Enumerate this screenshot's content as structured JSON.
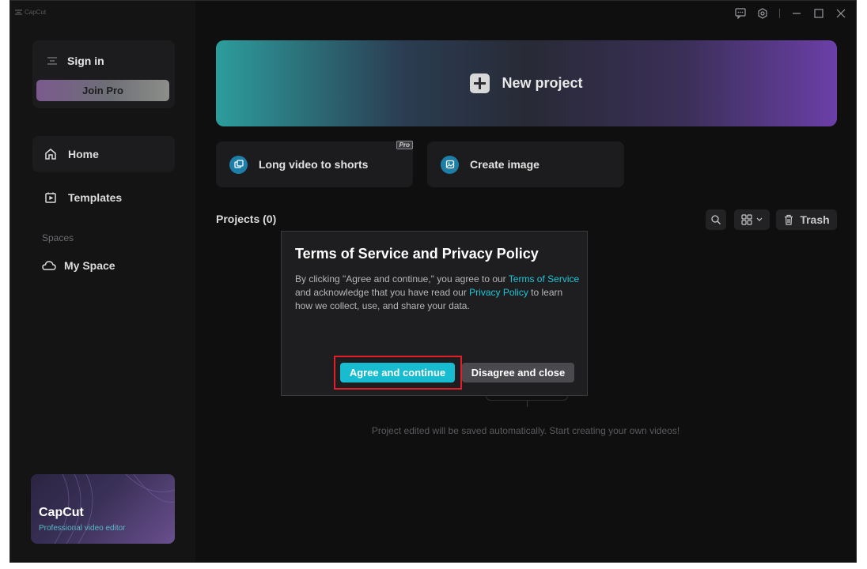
{
  "app": {
    "logo_text": "CapCut"
  },
  "sidebar": {
    "sign_in": "Sign in",
    "join_pro": "Join Pro",
    "nav": [
      {
        "label": "Home",
        "icon": "home-icon",
        "active": true
      },
      {
        "label": "Templates",
        "icon": "templates-icon",
        "active": false
      }
    ],
    "spaces_label": "Spaces",
    "my_space": "My Space",
    "promo": {
      "title": "CapCut",
      "subtitle": "Professional video editor"
    }
  },
  "main": {
    "new_project": "New project",
    "quick_actions": [
      {
        "label": "Long video to shorts",
        "badge": "Pro",
        "icon": "shorts-icon"
      },
      {
        "label": "Create image",
        "icon": "image-icon"
      }
    ],
    "projects_title": "Projects",
    "projects_count": "(0)",
    "trash_label": "Trash",
    "empty_text": "Project edited will be saved automatically. Start creating your own videos!"
  },
  "dialog": {
    "title": "Terms of Service and Privacy Policy",
    "body_1": "By clicking  \"Agree and continue,\"  you agree to our ",
    "terms_link": "Terms of Service",
    "body_2": " and acknowledge that you have read our ",
    "privacy_link": "Privacy Policy",
    "body_3": " to learn how we collect, use, and share your data.",
    "agree": "Agree and continue",
    "disagree": "Disagree and close"
  },
  "colors": {
    "accent": "#17bcd0",
    "link": "#1fc6d6",
    "highlight": "#e01f2a",
    "background": "#0f0f10"
  }
}
